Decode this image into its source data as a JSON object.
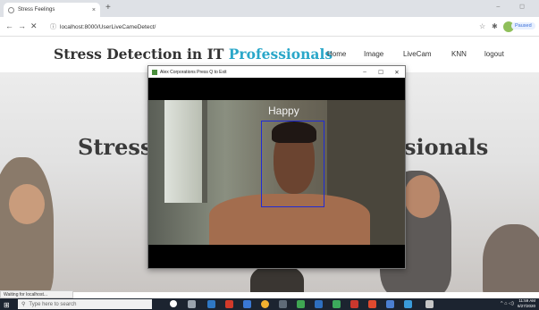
{
  "browser": {
    "tab_title": "Stress Feelings",
    "tab_close": "×",
    "new_tab": "+",
    "window_controls": "–  ◻",
    "url": "localhost:8000/UserLiveCameDetect/",
    "profile_status": "Paused"
  },
  "site": {
    "brand_main": "Stress Detection in IT ",
    "brand_accent": "Professionals",
    "menu": [
      "Home",
      "Image",
      "LiveCam",
      "KNN",
      "logout"
    ]
  },
  "hero": {
    "left_text": "Stress",
    "right_text": "sionals"
  },
  "camera_window": {
    "title": "Alex Corporations Press Q to Exit",
    "minimize": "–",
    "maximize": "☐",
    "close": "✕",
    "emotion_label": "Happy"
  },
  "statusbar": {
    "text": "Waiting for localhost..."
  },
  "taskbar": {
    "search_placeholder": "Type here to search",
    "clock_time": "11:59 AM",
    "clock_date": "6/27/2020"
  },
  "colors": {
    "brand_accent": "#2aa7c9",
    "face_box": "#1f2bd6",
    "taskbar": "#1c2430"
  }
}
